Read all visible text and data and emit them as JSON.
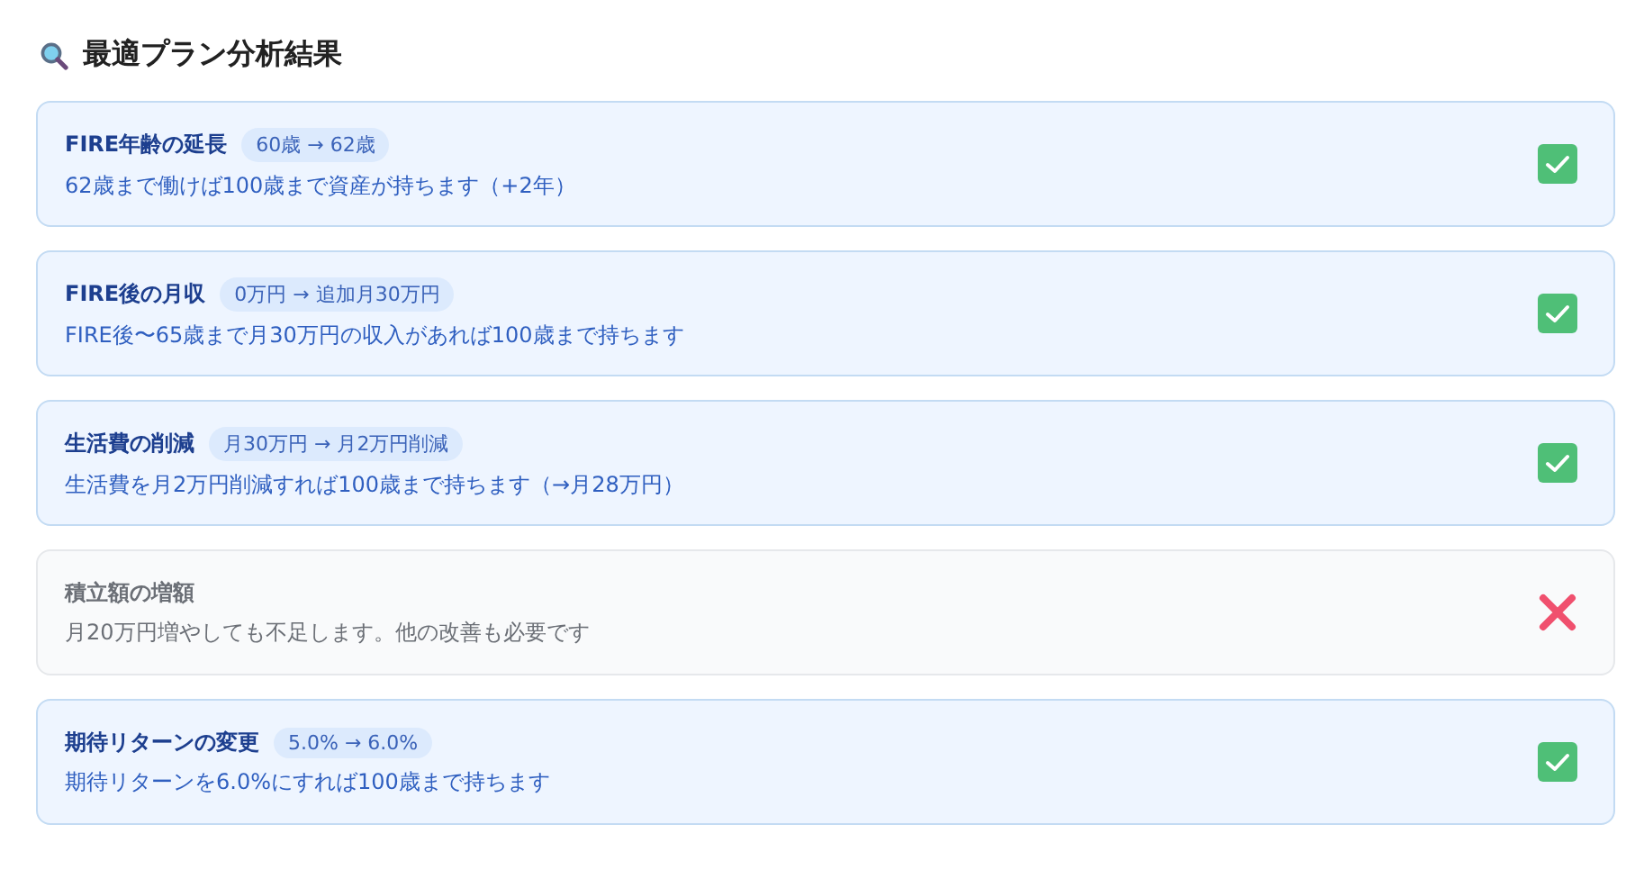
{
  "title": "最適プラン分析結果",
  "results": [
    {
      "name": "FIRE年齢の延長",
      "change": "60歳 → 62歳",
      "description": "62歳まで働けば100歳まで資産が持ちます（+2年）",
      "feasible": true
    },
    {
      "name": "FIRE後の月収",
      "change": "0万円 → 追加月30万円",
      "description": "FIRE後〜65歳まで月30万円の収入があれば100歳まで持ちます",
      "feasible": true
    },
    {
      "name": "生活費の削減",
      "change": "月30万円 → 月2万円削減",
      "description": "生活費を月2万円削減すれば100歳まで持ちます（→月28万円）",
      "feasible": true
    },
    {
      "name": "積立額の増額",
      "description": "月20万円増やしても不足します。他の改善も必要です",
      "feasible": false
    },
    {
      "name": "期待リターンの変更",
      "change": "5.0% → 6.0%",
      "description": "期待リターンを6.0%にすれば100歳まで持ちます",
      "feasible": true
    }
  ]
}
